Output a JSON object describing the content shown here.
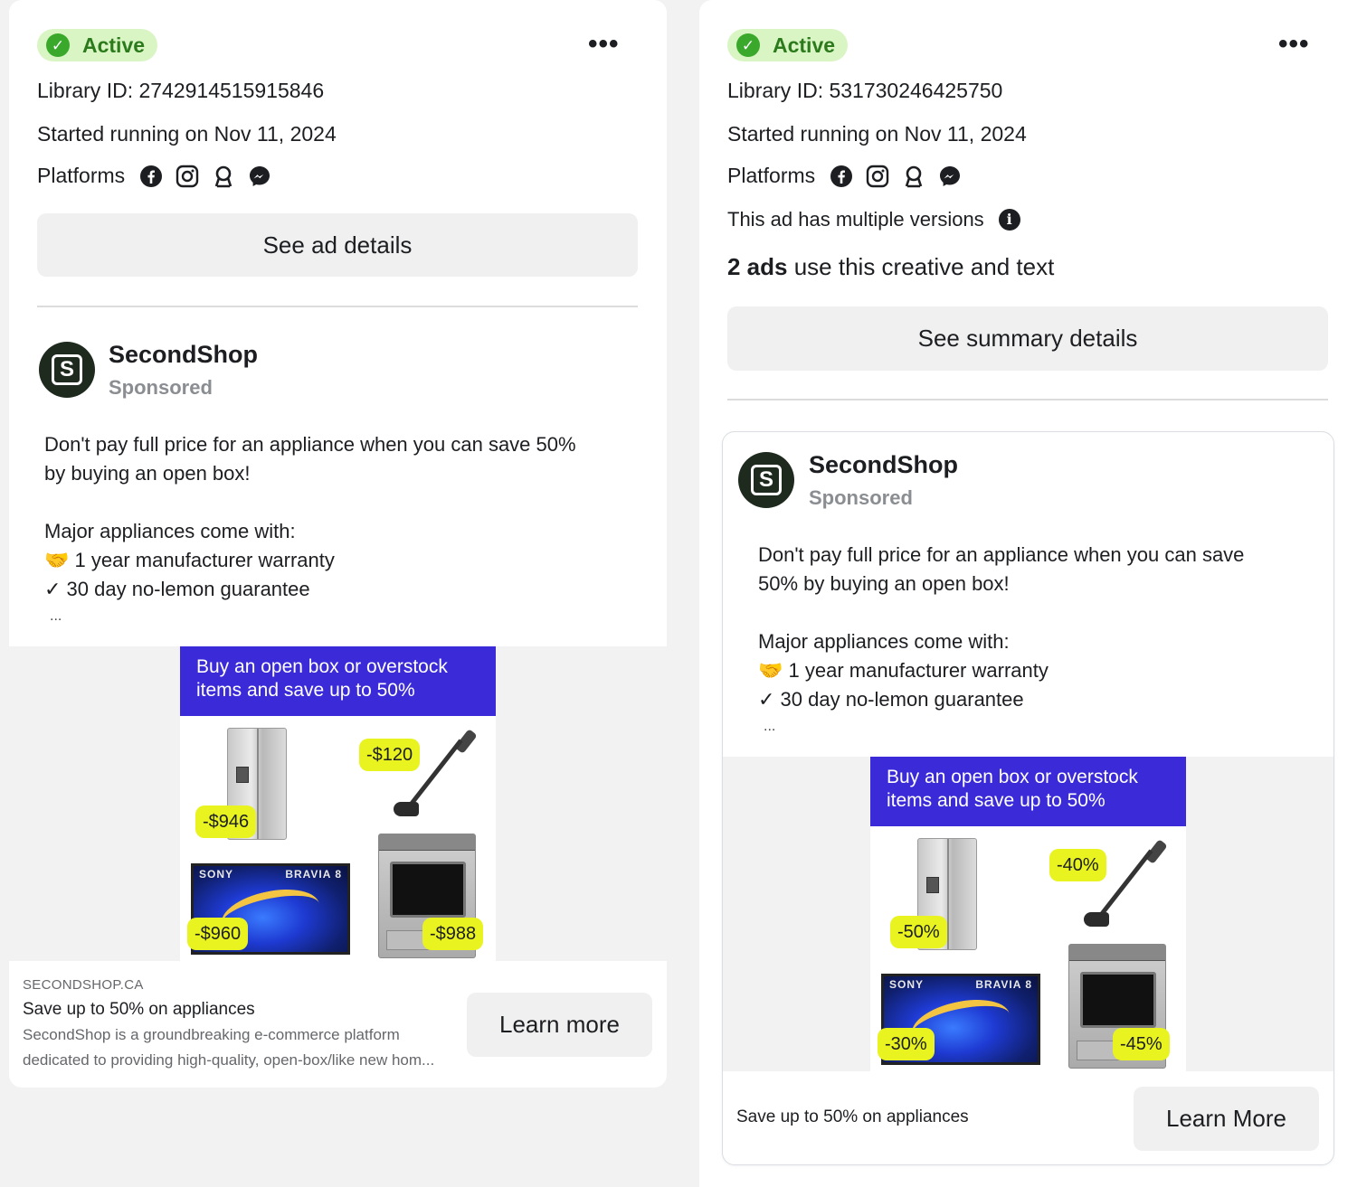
{
  "cards": [
    {
      "status": "Active",
      "library_id": "Library ID: 2742914515915846",
      "started": "Started running on Nov 11, 2024",
      "platforms_label": "Platforms",
      "platform_icons": [
        "facebook-icon",
        "instagram-icon",
        "audience-network-icon",
        "messenger-icon"
      ],
      "details_button": "See ad details",
      "advertiser": "SecondShop",
      "sponsored": "Sponsored",
      "body_line1": "Don't pay full price for an appliance when you can save 50%",
      "body_line2": "by buying an open box!",
      "body_line3": "Major appliances come with:",
      "body_line4": "🤝 1 year manufacturer warranty",
      "body_line5": "✓ 30 day no-lemon guarantee",
      "body_more": "...",
      "creative_banner_line1": "Buy an open box or overstock",
      "creative_banner_line2": "items and save up to 50%",
      "tags": {
        "fridge": "-$946",
        "vacuum": "-$120",
        "tv": "-$960",
        "range": "-$988"
      },
      "tv_brand_left": "SONY",
      "tv_brand_right": "BRAVIA 8",
      "footer_domain": "SECONDSHOP.CA",
      "footer_title": "Save up to 50% on appliances",
      "footer_desc_line1": "SecondShop is a groundbreaking e-commerce platform",
      "footer_desc_line2": "dedicated to providing high-quality, open-box/like new hom...",
      "cta": "Learn more"
    },
    {
      "status": "Active",
      "library_id": "Library ID: 531730246425750",
      "started": "Started running on Nov 11, 2024",
      "platforms_label": "Platforms",
      "platform_icons": [
        "facebook-icon",
        "instagram-icon",
        "audience-network-icon",
        "messenger-icon"
      ],
      "versions_note": "This ad has multiple versions",
      "ads_count": "2 ads",
      "ads_count_rest": " use this creative and text",
      "details_button": "See summary details",
      "advertiser": "SecondShop",
      "sponsored": "Sponsored",
      "body_line1": "Don't pay full price for an appliance when you can save",
      "body_line2": "50% by buying an open box!",
      "body_line3": "Major appliances come with:",
      "body_line4": "🤝 1 year manufacturer warranty",
      "body_line5": "✓ 30 day no-lemon guarantee",
      "body_more": "...",
      "creative_banner_line1": "Buy an open box or overstock",
      "creative_banner_line2": "items and save up to 50%",
      "tags": {
        "fridge": "-50%",
        "vacuum": "-40%",
        "tv": "-30%",
        "range": "-45%"
      },
      "tv_brand_left": "SONY",
      "tv_brand_right": "BRAVIA 8",
      "footer_title": "Save up to 50% on appliances",
      "cta": "Learn More"
    }
  ],
  "colors": {
    "active_bg": "#d9f5c4",
    "active_text": "#2b7a1c",
    "banner": "#3a2ad8",
    "tag": "#e9f31f"
  }
}
